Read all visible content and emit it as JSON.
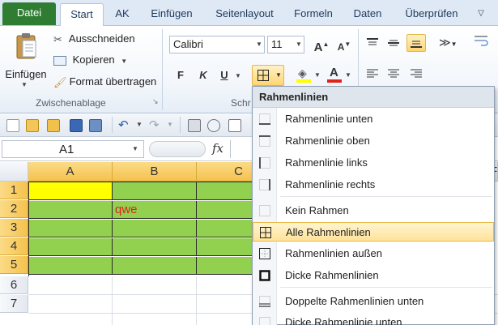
{
  "tabs": [
    "Datei",
    "Start",
    "AK",
    "Einfügen",
    "Seitenlayout",
    "Formeln",
    "Daten",
    "Überprüfen"
  ],
  "clipboard": {
    "paste_label": "Einfügen",
    "cut": "Ausschneiden",
    "copy": "Kopieren",
    "format_painter": "Format übertragen",
    "group_label": "Zwischenablage"
  },
  "font": {
    "name": "Calibri",
    "size": "11",
    "bold": "F",
    "italic": "K",
    "underline": "U",
    "group_label_partial": "Schr"
  },
  "namebox": "A1",
  "fx": "fx",
  "columns": [
    "A",
    "B",
    "C"
  ],
  "extra_col_partial": "F",
  "rows": [
    "1",
    "2",
    "3",
    "4",
    "5",
    "6",
    "7"
  ],
  "cells": {
    "B2": "qwe"
  },
  "colors": {
    "fill_green": "#92d050",
    "fill_yellow": "#ffff00",
    "text_red": "#e0231c",
    "file_tab": "#2f7d32"
  },
  "menu": {
    "title": "Rahmenlinien",
    "items": [
      "Rahmenlinie unten",
      "Rahmenlinie oben",
      "Rahmenlinie links",
      "Rahmenlinie rechts",
      "Kein Rahmen",
      "Alle Rahmenlinien",
      "Rahmenlinien außen",
      "Dicke Rahmenlinien",
      "Doppelte Rahmenlinien unten",
      "Dicke Rahmenlinie unten"
    ],
    "selected": "Alle Rahmenlinien"
  }
}
